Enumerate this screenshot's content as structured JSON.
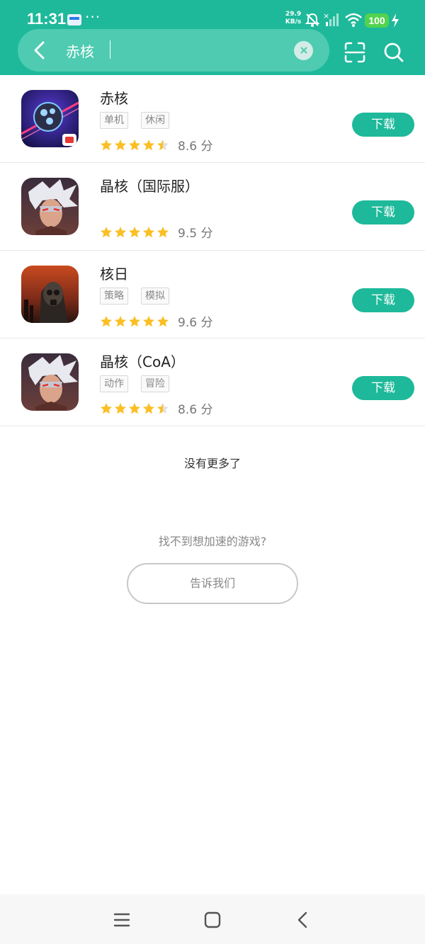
{
  "status_bar": {
    "time": "11:31",
    "more": "···",
    "net_speed_value": "29.9",
    "net_speed_unit": "KB/s",
    "battery": "100"
  },
  "search": {
    "value": "赤核",
    "clear_icon": "close-icon",
    "back_icon": "chevron-left-icon",
    "scan_icon": "scan-icon",
    "search_icon": "search-icon"
  },
  "results": [
    {
      "name": "赤核",
      "tags": [
        "单机",
        "休闲"
      ],
      "rating": 4.5,
      "score": "8.6 分",
      "button": "下载"
    },
    {
      "name": "晶核（国际服）",
      "tags": [],
      "rating": 5,
      "score": "9.5 分",
      "button": "下载"
    },
    {
      "name": "核日",
      "tags": [
        "策略",
        "模拟"
      ],
      "rating": 5,
      "score": "9.6 分",
      "button": "下载"
    },
    {
      "name": "晶核（CoA）",
      "tags": [
        "动作",
        "冒险"
      ],
      "rating": 4.5,
      "score": "8.6 分",
      "button": "下载"
    }
  ],
  "footer": {
    "no_more": "没有更多了",
    "cant_find": "找不到想加速的游戏?",
    "tell_us": "告诉我们"
  },
  "colors": {
    "accent": "#1db99a",
    "star": "#fbbf24"
  }
}
